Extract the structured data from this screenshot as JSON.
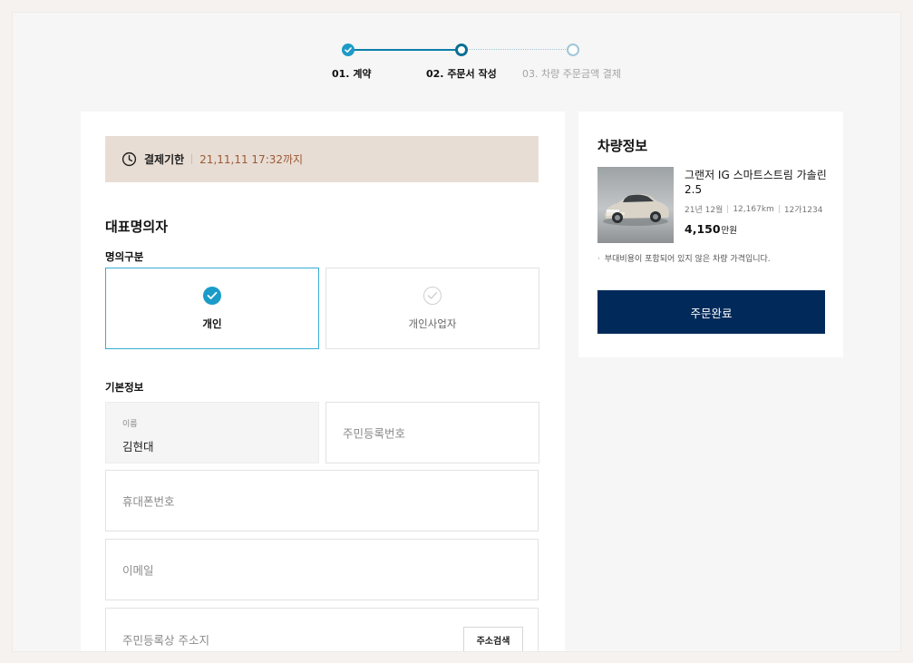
{
  "stepper": {
    "steps": [
      {
        "label": "01. 계약",
        "state": "done"
      },
      {
        "label": "02. 주문서 작성",
        "state": "active"
      },
      {
        "label": "03. 차량 주문금액 결제",
        "state": "todo"
      }
    ]
  },
  "deadline": {
    "label": "결제기한",
    "value": "21,11,11 17:32까지",
    "icon": "clock-icon"
  },
  "owner_section": {
    "title": "대표명의자",
    "type_title": "명의구분",
    "types": [
      {
        "label": "개인",
        "selected": true
      },
      {
        "label": "개인사업자",
        "selected": false
      }
    ],
    "basic_title": "기본정보",
    "name_field": {
      "label": "이름",
      "value": "김현대"
    },
    "ssn_field": {
      "placeholder": "주민등록번호"
    },
    "phone_field": {
      "placeholder": "휴대폰번호"
    },
    "email_field": {
      "placeholder": "이메일"
    },
    "address_field": {
      "placeholder": "주민등록상 주소지",
      "search_button": "주소검색"
    }
  },
  "vehicle": {
    "title": "차량정보",
    "name": "그랜저 IG 스마트스트림 가솔린 2.5",
    "meta": [
      "21년 12월",
      "12,167km",
      "12가1234"
    ],
    "price": "4,150",
    "price_unit": "만원",
    "note": "부대비용이 포함되어 있지 않은 차량 가격입니다.",
    "order_button": "주문완료"
  },
  "colors": {
    "accent": "#1b9bc7",
    "primary_button": "#012a5a",
    "deadline_bg": "#e8ddd4",
    "deadline_text": "#9b5a37"
  }
}
